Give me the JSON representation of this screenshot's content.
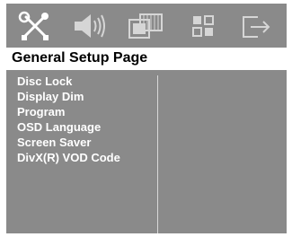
{
  "tabs": [
    {
      "icon": "tools-icon",
      "name": "General Setup",
      "selected": true
    },
    {
      "icon": "speaker-icon",
      "name": "Audio Setup",
      "selected": false
    },
    {
      "icon": "film-icon",
      "name": "Video Setup",
      "selected": false
    },
    {
      "icon": "preferences-icon",
      "name": "Preference",
      "selected": false
    },
    {
      "icon": "exit-icon",
      "name": "Exit",
      "selected": false
    }
  ],
  "page_title": "General Setup Page",
  "menu_items": [
    "Disc Lock",
    "Display Dim",
    "Program",
    "OSD Language",
    "Screen Saver",
    "DivX(R) VOD Code"
  ],
  "colors": {
    "background": "#8a8a8a",
    "title_bar": "#ffffff",
    "menu_text": "#ffffff",
    "icon_selected": "#ffffff",
    "icon_normal": "#d0d0d0"
  }
}
